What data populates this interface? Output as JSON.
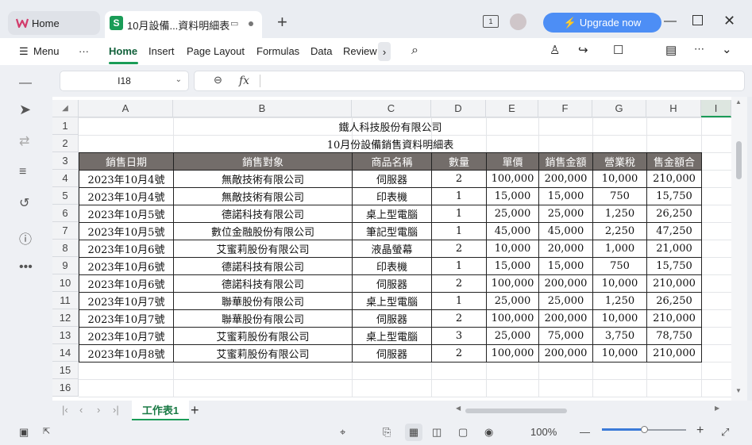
{
  "titlebar": {
    "home_tab": "Home",
    "doc_tab": "10月設備...資料明細表",
    "new_tab": "+",
    "upgrade": "Upgrade now",
    "page_badge": "1"
  },
  "ribbon": {
    "menu": "Menu",
    "more": "···",
    "tabs": [
      "Home",
      "Insert",
      "Page Layout",
      "Formulas",
      "Data",
      "Review"
    ]
  },
  "formula_bar": {
    "cell_ref": "I18",
    "fx": "fx",
    "value": ""
  },
  "columns": [
    "A",
    "B",
    "C",
    "D",
    "E",
    "F",
    "G",
    "H",
    "I"
  ],
  "rows": [
    "1",
    "2",
    "3",
    "4",
    "5",
    "6",
    "7",
    "8",
    "9",
    "10",
    "11",
    "12",
    "13",
    "14",
    "15",
    "16"
  ],
  "sheet": {
    "title": "鐵人科技股份有限公司",
    "subtitle": "10月份設備銷售資料明細表",
    "headers": [
      "銷售日期",
      "銷售對象",
      "商品名稱",
      "數量",
      "單價",
      "銷售金額",
      "營業稅",
      "售金額合"
    ],
    "data": [
      [
        "2023年10月4號",
        "無敵技術有限公司",
        "伺服器",
        "2",
        "100,000",
        "200,000",
        "10,000",
        "210,000"
      ],
      [
        "2023年10月4號",
        "無敵技術有限公司",
        "印表機",
        "1",
        "15,000",
        "15,000",
        "750",
        "15,750"
      ],
      [
        "2023年10月5號",
        "德諾科技有限公司",
        "桌上型電腦",
        "1",
        "25,000",
        "25,000",
        "1,250",
        "26,250"
      ],
      [
        "2023年10月5號",
        "數位金融股份有限公司",
        "筆記型電腦",
        "1",
        "45,000",
        "45,000",
        "2,250",
        "47,250"
      ],
      [
        "2023年10月6號",
        "艾蜜莉股份有限公司",
        "液晶螢幕",
        "2",
        "10,000",
        "20,000",
        "1,000",
        "21,000"
      ],
      [
        "2023年10月6號",
        "德諾科技有限公司",
        "印表機",
        "1",
        "15,000",
        "15,000",
        "750",
        "15,750"
      ],
      [
        "2023年10月6號",
        "德諾科技有限公司",
        "伺服器",
        "2",
        "100,000",
        "200,000",
        "10,000",
        "210,000"
      ],
      [
        "2023年10月7號",
        "聯華股份有限公司",
        "桌上型電腦",
        "1",
        "25,000",
        "25,000",
        "1,250",
        "26,250"
      ],
      [
        "2023年10月7號",
        "聯華股份有限公司",
        "伺服器",
        "2",
        "100,000",
        "200,000",
        "10,000",
        "210,000"
      ],
      [
        "2023年10月7號",
        "艾蜜莉股份有限公司",
        "桌上型電腦",
        "3",
        "25,000",
        "75,000",
        "3,750",
        "78,750"
      ],
      [
        "2023年10月8號",
        "艾蜜莉股份有限公司",
        "伺服器",
        "2",
        "100,000",
        "200,000",
        "10,000",
        "210,000"
      ]
    ]
  },
  "sheet_tabs": [
    "工作表1"
  ],
  "add_sheet": "+",
  "status": {
    "zoom": "100%",
    "zoom_level": 0.5
  }
}
